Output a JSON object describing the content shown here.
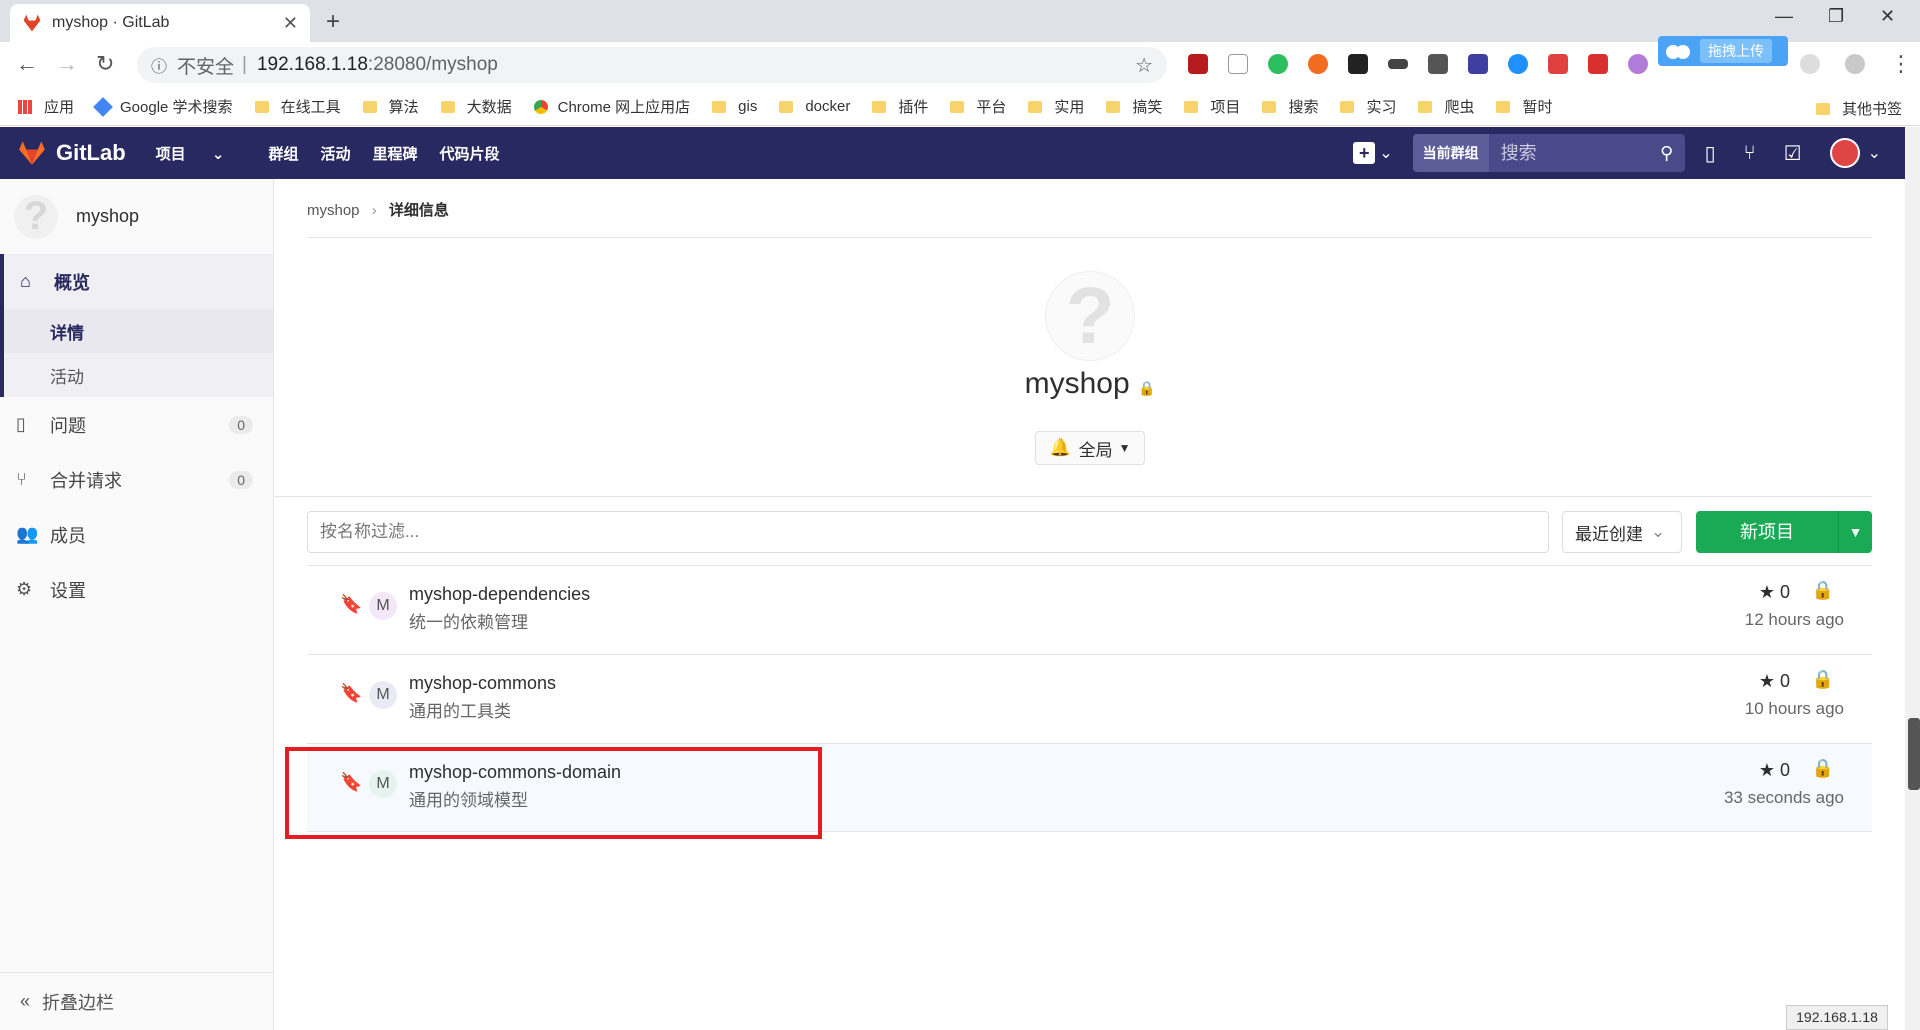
{
  "browser": {
    "tab_title": "myshop · GitLab",
    "new_tab": "+",
    "minimize": "—",
    "maximize": "❐",
    "close": "✕",
    "address": {
      "security": "不安全",
      "separator": "|",
      "host": "192.168.1.18",
      "path": ":28080/myshop"
    },
    "baidu_upload": "拖拽上传"
  },
  "bookmarks": {
    "items": [
      "应用",
      "Google 学术搜索",
      "在线工具",
      "算法",
      "大数据",
      "Chrome 网上应用店",
      "gis",
      "docker",
      "插件",
      "平台",
      "实用",
      "搞笑",
      "项目",
      "搜索",
      "实习",
      "爬虫",
      "暂时"
    ],
    "other": "其他书签"
  },
  "gitlab": {
    "brand": "GitLab",
    "nav": [
      "项目",
      "群组",
      "活动",
      "里程碑",
      "代码片段"
    ],
    "search_scope": "当前群组",
    "search_placeholder": "搜索"
  },
  "sidebar": {
    "group_name": "myshop",
    "overview": "概览",
    "overview_sub": [
      "详情",
      "活动"
    ],
    "issues": "问题",
    "issues_count": "0",
    "merge_requests": "合并请求",
    "mr_count": "0",
    "members": "成员",
    "settings": "设置",
    "collapse": "折叠边栏"
  },
  "main": {
    "breadcrumb_root": "myshop",
    "breadcrumb_current": "详细信息",
    "group_title": "myshop",
    "notification": "全局",
    "filter_placeholder": "按名称过滤...",
    "sort": "最近创建",
    "new_project": "新项目",
    "projects": [
      {
        "avatar": "M",
        "name": "myshop-dependencies",
        "desc": "统一的依赖管理",
        "stars": "0",
        "time": "12 hours ago",
        "avatar_color": "#f4e7f7"
      },
      {
        "avatar": "M",
        "name": "myshop-commons",
        "desc": "通用的工具类",
        "stars": "0",
        "time": "10 hours ago",
        "avatar_color": "#eaeaf5"
      },
      {
        "avatar": "M",
        "name": "myshop-commons-domain",
        "desc": "通用的领域模型",
        "stars": "0",
        "time": "33 seconds ago",
        "avatar_color": "#e6f3ee"
      }
    ]
  },
  "status_url": "192.168.1.18",
  "colors": {
    "header": "#292961",
    "primary_button": "#1aaa55",
    "highlight_box": "#e61b23"
  }
}
